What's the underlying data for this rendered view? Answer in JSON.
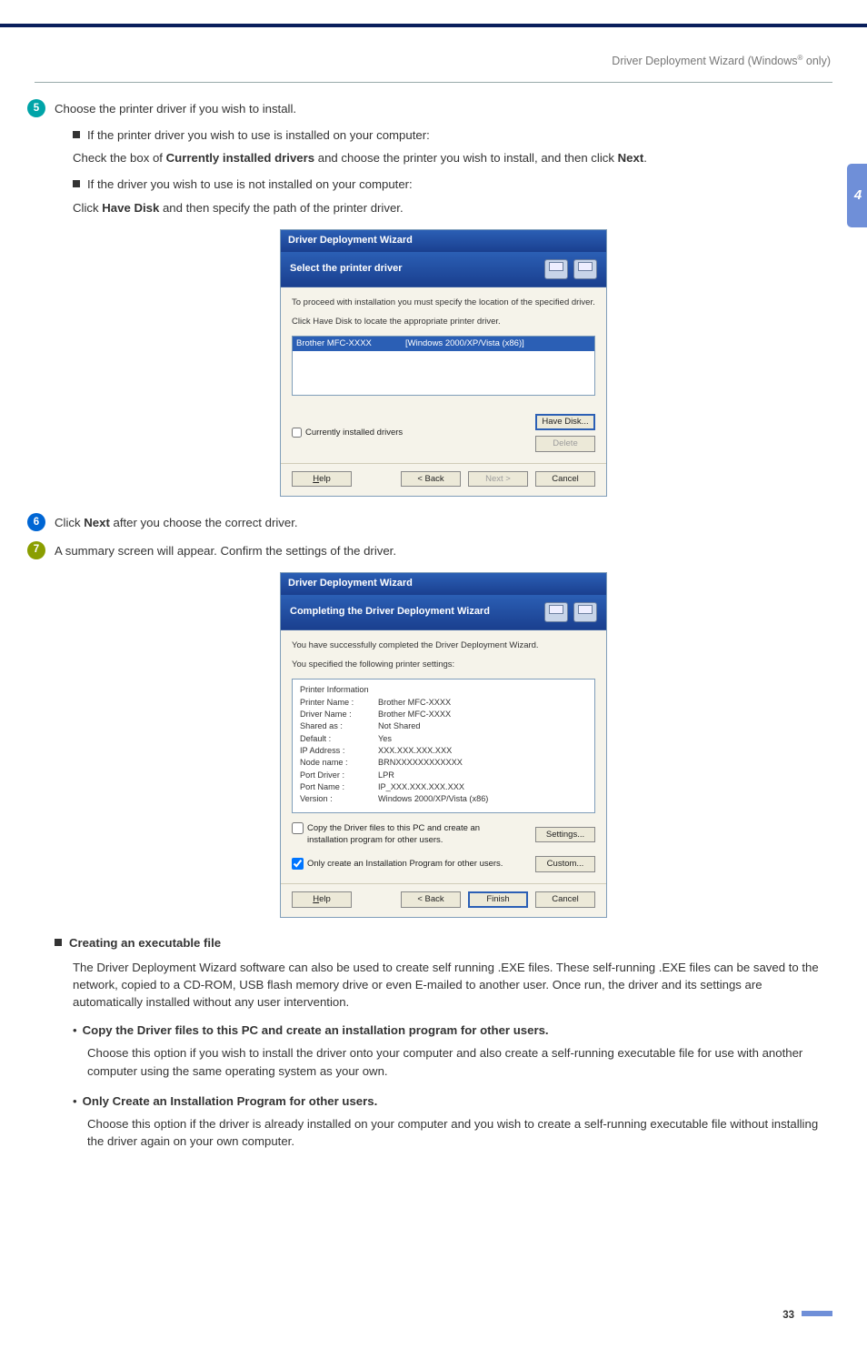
{
  "header": {
    "breadcrumb_prefix": "Driver Deployment Wizard (Windows",
    "breadcrumb_sup": "®",
    "breadcrumb_suffix": " only)"
  },
  "section_tab": "4",
  "steps": {
    "s5": {
      "text": "Choose the printer driver if you wish to install.",
      "sub1": "If the printer driver you wish to use is installed on your computer:",
      "body1a": "Check the box of ",
      "body1_bold": "Currently installed drivers",
      "body1b": " and choose the printer you wish to install, and then click ",
      "body1_bold2": "Next",
      "body1c": ".",
      "sub2": "If the driver you wish to use is not installed on your computer:",
      "body2a": "Click ",
      "body2_bold": "Have Disk",
      "body2b": " and then specify the path of the printer driver."
    },
    "s6": {
      "a": "Click ",
      "bold": "Next",
      "b": " after you choose the correct driver."
    },
    "s7": {
      "text": "A summary screen will appear. Confirm the settings of the driver."
    }
  },
  "dialog1": {
    "title": "Driver Deployment Wizard",
    "banner": "Select the printer driver",
    "line1": "To proceed with installation you must specify the location of the specified driver.",
    "line2": "Click Have Disk to locate the appropriate printer driver.",
    "list_name": "Brother   MFC-XXXX",
    "list_os": "[Windows 2000/XP/Vista (x86)]",
    "checkbox": "Currently installed drivers",
    "btn_havedisk": "Have Disk...",
    "btn_delete": "Delete",
    "btn_help": "Help",
    "btn_back": "< Back",
    "btn_next": "Next >",
    "btn_cancel": "Cancel"
  },
  "dialog2": {
    "title": "Driver Deployment Wizard",
    "banner": "Completing the Driver Deployment Wizard",
    "line1": "You have successfully completed the Driver Deployment Wizard.",
    "line2": "You specified the following printer settings:",
    "info_header": "Printer Information",
    "rows": [
      {
        "lbl": "Printer Name :",
        "val": "Brother  MFC-XXXX"
      },
      {
        "lbl": "Driver Name :",
        "val": "Brother  MFC-XXXX"
      },
      {
        "lbl": "Shared as :",
        "val": "Not Shared"
      },
      {
        "lbl": "Default :",
        "val": "Yes"
      },
      {
        "lbl": "IP Address :",
        "val": "XXX.XXX.XXX.XXX"
      },
      {
        "lbl": "Node name :",
        "val": "BRNXXXXXXXXXXXX"
      },
      {
        "lbl": "Port Driver :",
        "val": "LPR"
      },
      {
        "lbl": "Port Name :",
        "val": "IP_XXX.XXX.XXX.XXX"
      },
      {
        "lbl": "Version :",
        "val": "Windows 2000/XP/Vista (x86)"
      }
    ],
    "opt1": "Copy the Driver files to this PC and create an installation program for other users.",
    "opt2": "Only create an Installation Program for other users.",
    "btn_settings": "Settings...",
    "btn_custom": "Custom...",
    "btn_help": "Help",
    "btn_back": "< Back",
    "btn_finish": "Finish",
    "btn_cancel": "Cancel"
  },
  "exe": {
    "heading": "Creating an executable file",
    "para": "The Driver Deployment Wizard software can also be used to create self running .EXE files. These self-running .EXE files can be saved to the network, copied to a CD-ROM, USB flash memory drive or even E-mailed to another user. Once run, the driver and its settings are automatically installed without any user intervention.",
    "b1": "Copy the Driver files to this PC and create an installation program for other users.",
    "b1_para": "Choose this option if you wish to install the driver onto your computer and also create a self-running executable file for use with another computer using the same operating system as your own.",
    "b2": "Only Create an Installation Program for other users.",
    "b2_para": "Choose this option if the driver is already installed on your computer and you wish to create a self-running executable file without installing the driver again on your own computer."
  },
  "page_number": "33"
}
